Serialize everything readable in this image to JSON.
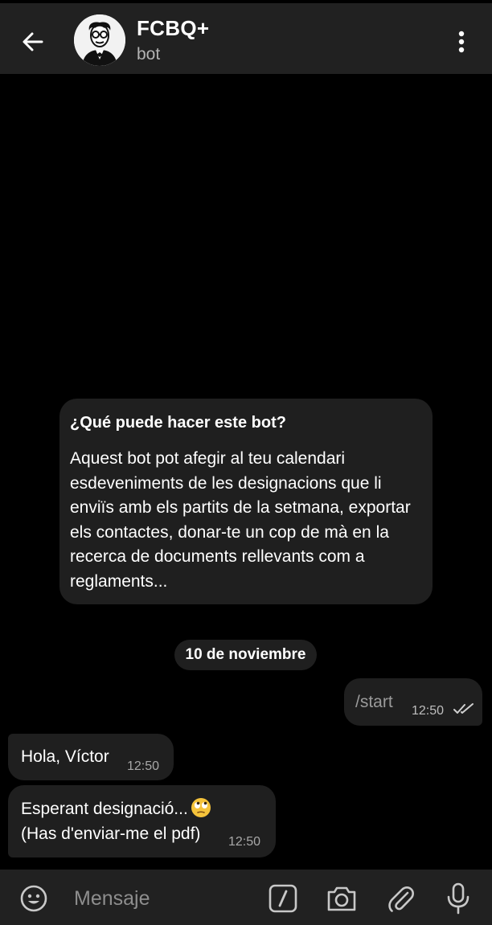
{
  "header": {
    "title": "FCBQ+",
    "subtitle": "bot"
  },
  "info_card": {
    "title": "¿Qué puede hacer este bot?",
    "body": "Aquest bot pot afegir al teu calendari esdeveniments de les designacions que li enviïs amb els partits de la setmana, exportar els contactes, donar-te un cop de mà en la recerca de documents rellevants com a reglaments..."
  },
  "date_separator": "10 de noviembre",
  "messages": [
    {
      "direction": "out",
      "text": "/start",
      "time": "12:50",
      "status": "read"
    },
    {
      "direction": "in",
      "text": "Hola, Víctor",
      "time": "12:50"
    },
    {
      "direction": "in",
      "text_line1": "Esperant designació...",
      "text_line2": "(Has d'enviar-me el pdf)",
      "emoji": "face-with-rolling-eyes",
      "time": "12:50"
    }
  ],
  "composer": {
    "placeholder": "Mensaje"
  },
  "colors": {
    "background": "#000000",
    "header": "#212121",
    "bubble": "#1f1f1f",
    "secondary_text": "#b3b3b3",
    "emoji_yellow": "#f5c33b"
  },
  "icons": [
    "back-arrow-icon",
    "bot-avatar",
    "more-vertical-icon",
    "double-check-icon",
    "emoji-icon",
    "bot-command-icon",
    "camera-icon",
    "paperclip-icon",
    "microphone-icon"
  ]
}
